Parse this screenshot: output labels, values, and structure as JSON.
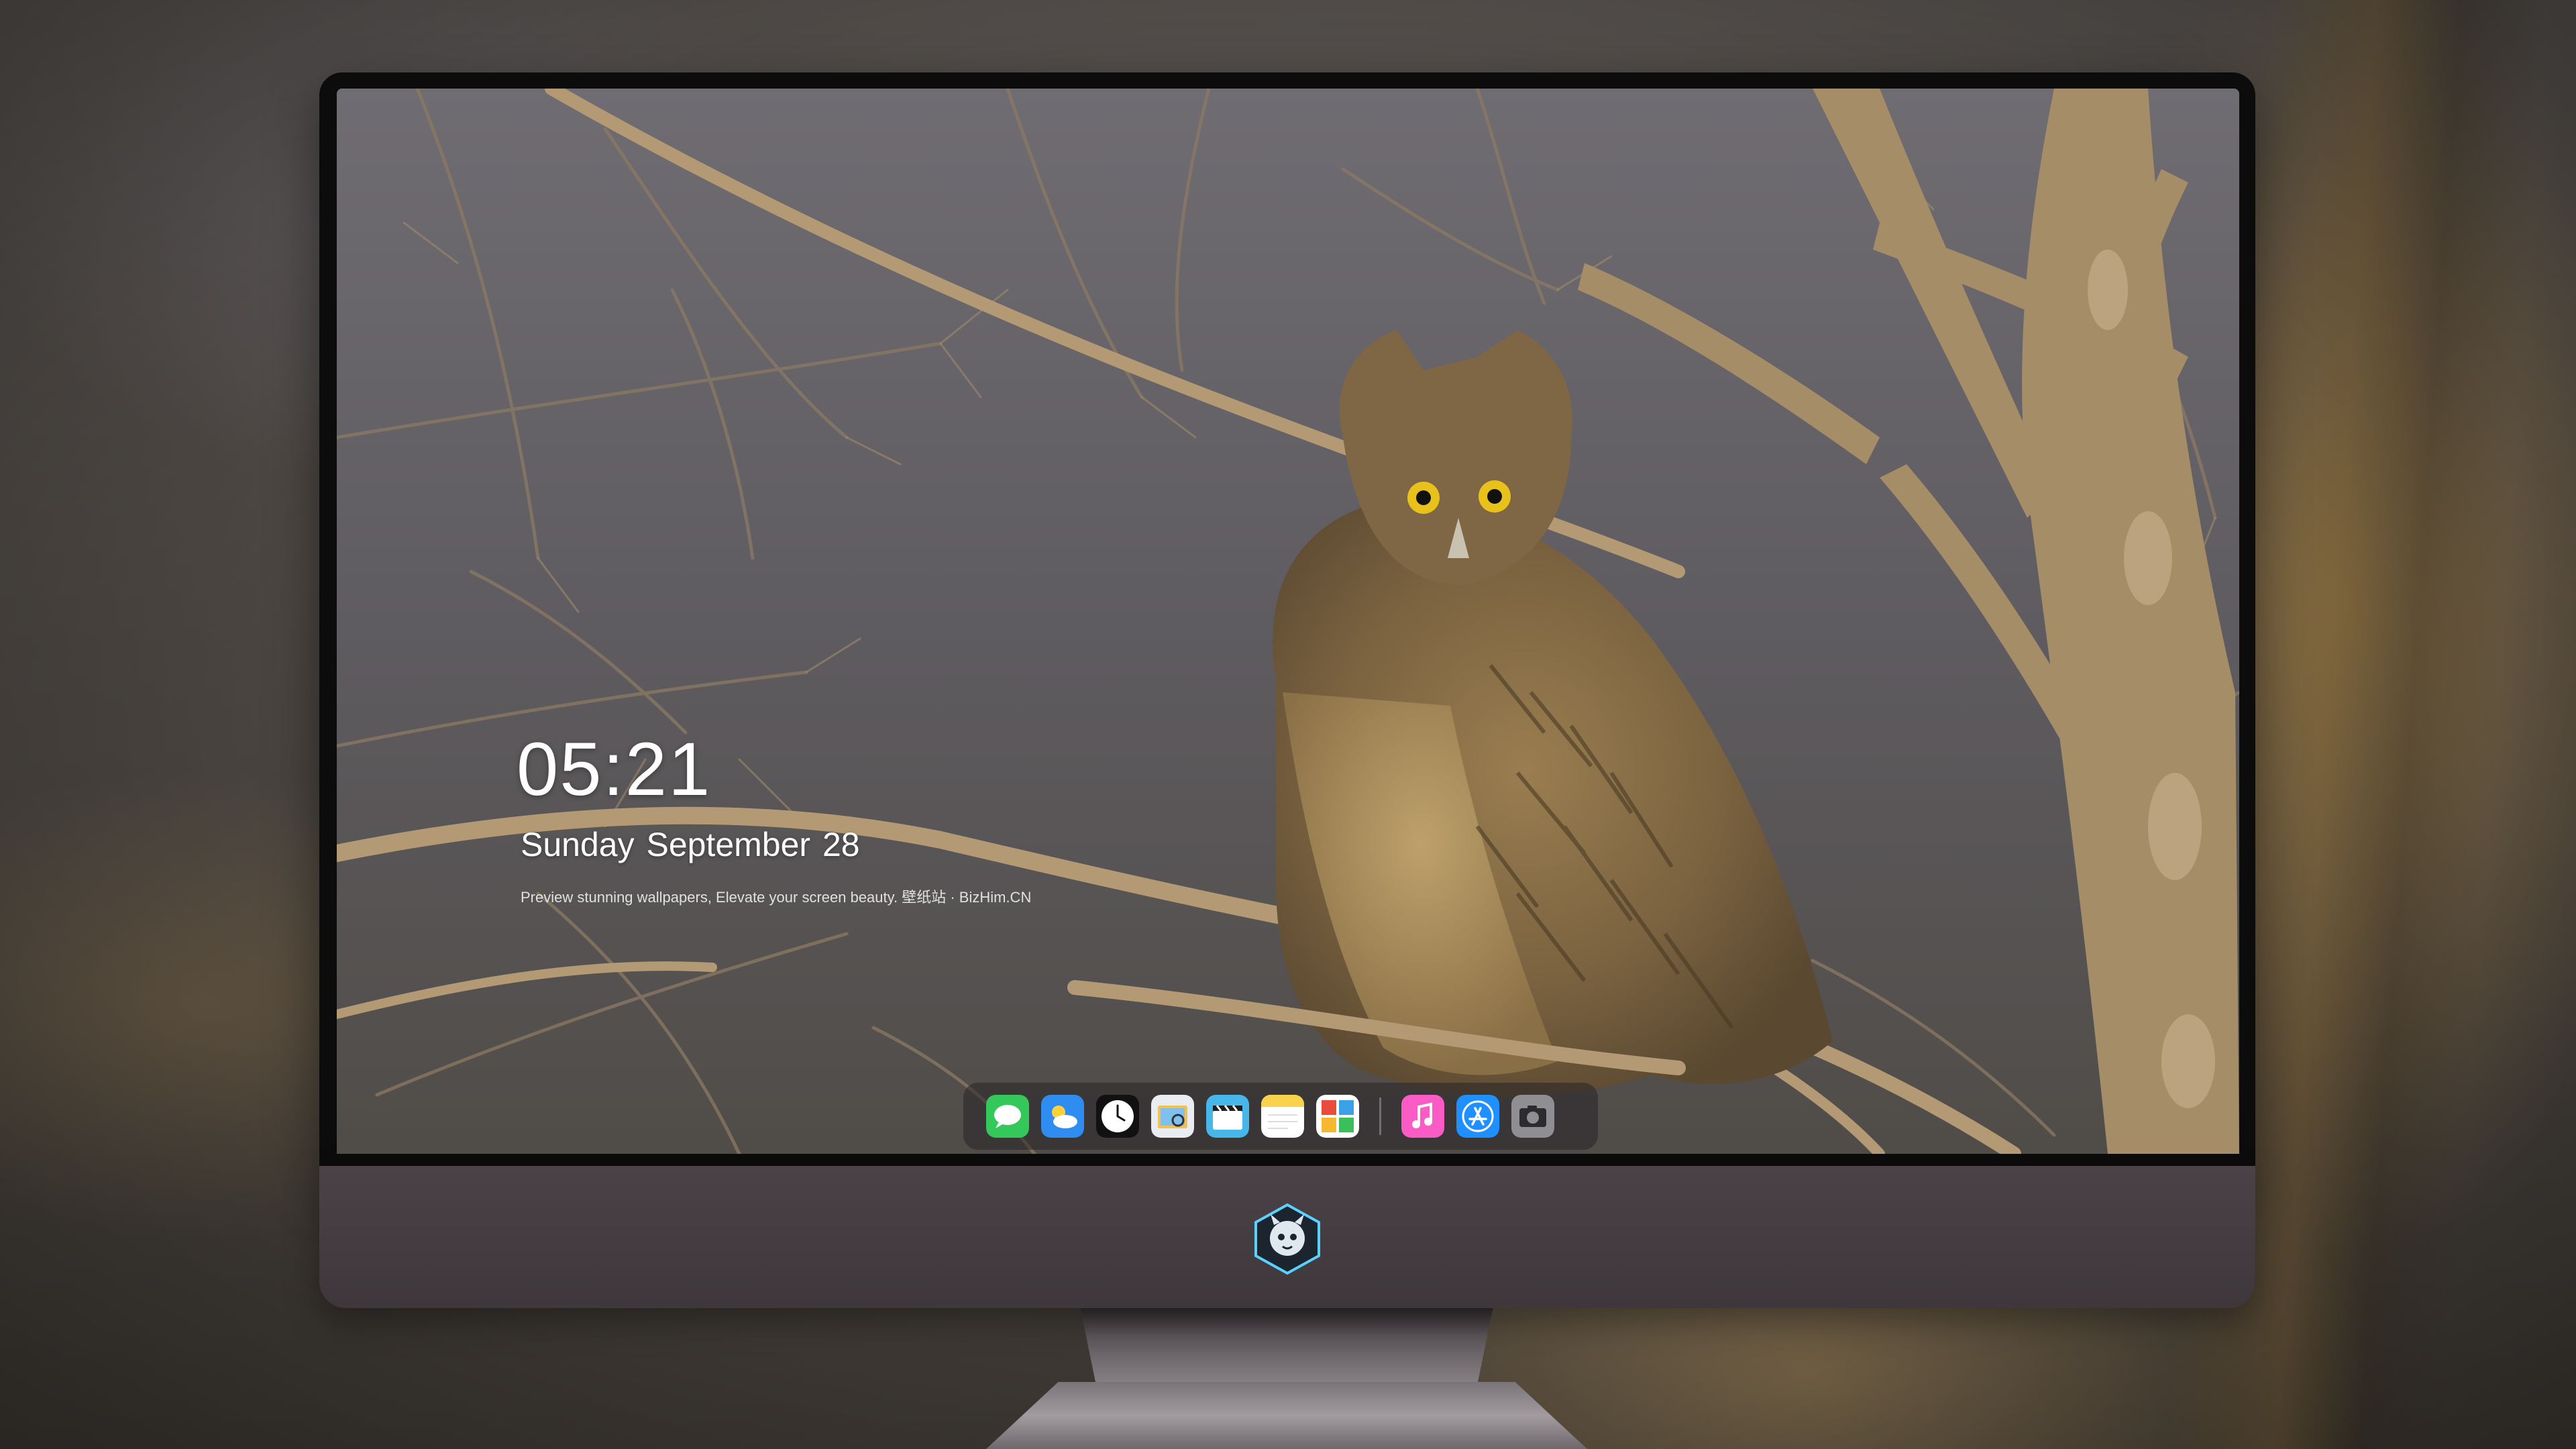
{
  "lock_screen": {
    "time": "05:21",
    "date": "Sunday September  28",
    "tagline": "Preview stunning wallpapers, Elevate your screen beauty. 壁纸站 · BizHim.CN"
  },
  "wallpaper": {
    "subject_icon": "owl-wallpaper",
    "palette": {
      "sky": "#5e5b60",
      "branch": "#b59b76",
      "owl_body": "#7a6442",
      "owl_eye": "#e8c21a"
    }
  },
  "dock": {
    "apps": [
      {
        "name": "messages",
        "icon": "messages-icon",
        "color": "#34c759"
      },
      {
        "name": "weather",
        "icon": "weather-icon",
        "color": "#2f8cf0"
      },
      {
        "name": "clock",
        "icon": "clock-icon",
        "color": "#111111"
      },
      {
        "name": "preview",
        "icon": "preview-icon",
        "color": "#f2c14e"
      },
      {
        "name": "clips",
        "icon": "clapperboard-icon",
        "color": "#47b6e8"
      },
      {
        "name": "notes",
        "icon": "notes-icon",
        "color": "#f7d24a"
      },
      {
        "name": "photo-booth",
        "icon": "photo-booth-icon",
        "color": "#e94b3c"
      },
      {
        "name": "music",
        "icon": "music-icon",
        "color": "#fb5bc5"
      },
      {
        "name": "app-store",
        "icon": "app-store-icon",
        "color": "#1e90ff"
      },
      {
        "name": "camera",
        "icon": "camera-icon",
        "color": "#8e8e93"
      }
    ]
  },
  "monitor": {
    "chin_logo_icon": "dragon-mascot-logo-icon",
    "frame_color": "#0c0c0d",
    "chin_color": "#433b3f"
  }
}
